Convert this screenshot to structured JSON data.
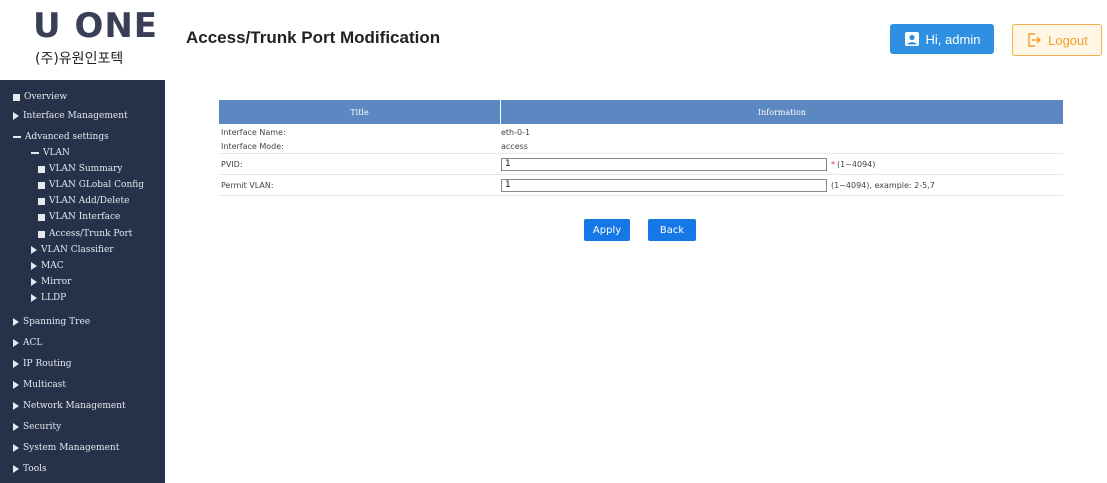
{
  "header": {
    "logo_main": "U ONE",
    "logo_sub": "(주)유원인포텍",
    "page_title": "Access/Trunk Port Modification",
    "user_label": "Hi, admin",
    "logout_label": "Logout"
  },
  "sidebar": {
    "items": [
      {
        "label": "Overview",
        "marker": "square"
      },
      {
        "label": "Interface Management",
        "marker": "triangle"
      },
      {
        "label": "Advanced settings",
        "marker": "dash"
      },
      {
        "label": "VLAN",
        "marker": "dash"
      },
      {
        "label": "VLAN Summary",
        "marker": "square"
      },
      {
        "label": "VLAN GLobal Config",
        "marker": "square"
      },
      {
        "label": "VLAN Add/Delete",
        "marker": "square"
      },
      {
        "label": "VLAN Interface",
        "marker": "square"
      },
      {
        "label": "Access/Trunk Port",
        "marker": "square"
      },
      {
        "label": "VLAN Classifier",
        "marker": "triangle"
      },
      {
        "label": "MAC",
        "marker": "triangle"
      },
      {
        "label": "Mirror",
        "marker": "triangle"
      },
      {
        "label": "LLDP",
        "marker": "triangle"
      },
      {
        "label": "Spanning Tree",
        "marker": "triangle"
      },
      {
        "label": "ACL",
        "marker": "triangle"
      },
      {
        "label": "IP Routing",
        "marker": "triangle"
      },
      {
        "label": "Multicast",
        "marker": "triangle"
      },
      {
        "label": "Network Management",
        "marker": "triangle"
      },
      {
        "label": "Security",
        "marker": "triangle"
      },
      {
        "label": "System Management",
        "marker": "triangle"
      },
      {
        "label": "Tools",
        "marker": "triangle"
      }
    ]
  },
  "table": {
    "col_title": "Title",
    "col_info": "Information",
    "rows": {
      "interface_name": {
        "label": "Interface Name:",
        "value": "eth-0-1"
      },
      "interface_mode": {
        "label": "Interface Mode:",
        "value": "access"
      },
      "pvid": {
        "label": "PVID:",
        "value": "1",
        "required": "*",
        "hint": "(1~4094)"
      },
      "permit_vlan": {
        "label": "Permit VLAN:",
        "value": "1",
        "hint": "(1~4094), example: 2-5,7"
      }
    }
  },
  "buttons": {
    "apply": "Apply",
    "back": "Back"
  },
  "colors": {
    "sidebar_bg": "#26314a",
    "table_header": "#5b88c0",
    "primary_button": "#1677e6",
    "user_button": "#2f8fe0",
    "logout_border": "#f0b04a"
  }
}
